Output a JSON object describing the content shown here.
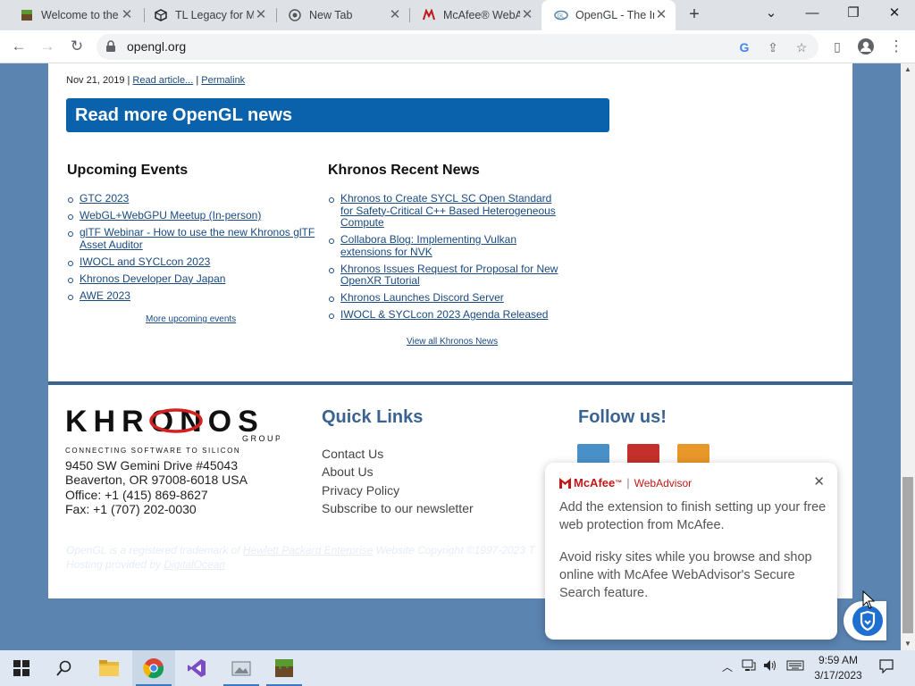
{
  "browser": {
    "tabs": [
      {
        "title": "Welcome to the",
        "icon": "minecraft-icon"
      },
      {
        "title": "TL Legacy for M",
        "icon": "cube-icon"
      },
      {
        "title": "New Tab",
        "icon": "chrome-icon"
      },
      {
        "title": "McAfee® WebA",
        "icon": "mcafee-icon"
      },
      {
        "title": "OpenGL - The In",
        "icon": "opengl-icon",
        "active": true
      }
    ],
    "url": "opengl.org"
  },
  "page": {
    "news_meta": {
      "date": "Nov 21, 2019",
      "sep1": "|",
      "read": "Read article...",
      "sep2": "|",
      "permalink": "Permalink"
    },
    "banner": "Read more OpenGL news",
    "events": {
      "title": "Upcoming Events",
      "items": [
        "GTC 2023",
        "WebGL+WebGPU Meetup (In-person)",
        "glTF Webinar - How to use the new Khronos glTF Asset Auditor",
        "IWOCL and SYCLcon 2023",
        "Khronos Developer Day Japan",
        "AWE 2023"
      ],
      "more": "More upcoming events"
    },
    "news": {
      "title": "Khronos Recent News",
      "items": [
        "Khronos to Create SYCL SC Open Standard for Safety-Critical C++ Based Heterogeneous Compute",
        "Collabora Blog: Implementing Vulkan extensions for NVK",
        "Khronos Issues Request for Proposal for New OpenXR Tutorial",
        "Khronos Launches Discord Server",
        "IWOCL & SYCLcon 2023 Agenda Released"
      ],
      "more": "View all Khronos News"
    },
    "footer": {
      "logo_text": "KHRONOS",
      "logo_group": "GROUP",
      "logo_tagline": "CONNECTING SOFTWARE TO SILICON",
      "address": [
        "9450 SW Gemini Drive #45043",
        "Beaverton, OR 97008-6018 USA",
        "Office: +1 (415) 869-8627",
        "Fax: +1 (707) 202-0030"
      ],
      "quick_links_title": "Quick Links",
      "quick_links": [
        "Contact Us",
        "About Us",
        "Privacy Policy",
        "Subscribe to our newsletter"
      ],
      "follow_title": "Follow us!",
      "social": [
        {
          "name": "twitter-icon",
          "color": "#4a90c8"
        },
        {
          "name": "youtube-icon",
          "color": "#c4302b"
        },
        {
          "name": "rss-icon",
          "color": "#e8972b"
        }
      ]
    },
    "legal": {
      "line1_a": "OpenGL is a registered trademark of ",
      "line1_link": "Hewlett Packard Enterprise",
      "line1_b": " Website Copyright ©1997-2023 T",
      "line2_a": "Hosting provided by ",
      "line2_link": "DigitalOcean"
    }
  },
  "mcafee_popup": {
    "brand": "McAfee",
    "tm": "™",
    "sep": "|",
    "product": "WebAdvisor",
    "paragraph1": "Add the extension to finish setting up your free web protection from McAfee.",
    "paragraph2": "Avoid risky sites while you browse and shop online with McAfee WebAdvisor's Secure Search feature."
  },
  "taskbar": {
    "time": "9:59 AM",
    "date": "3/17/2023"
  },
  "colors": {
    "page_bg": "#5b84b1",
    "banner": "#0b62ac",
    "accent": "#3a6391",
    "link": "#1a4a80",
    "mcafee_red": "#c01818"
  }
}
